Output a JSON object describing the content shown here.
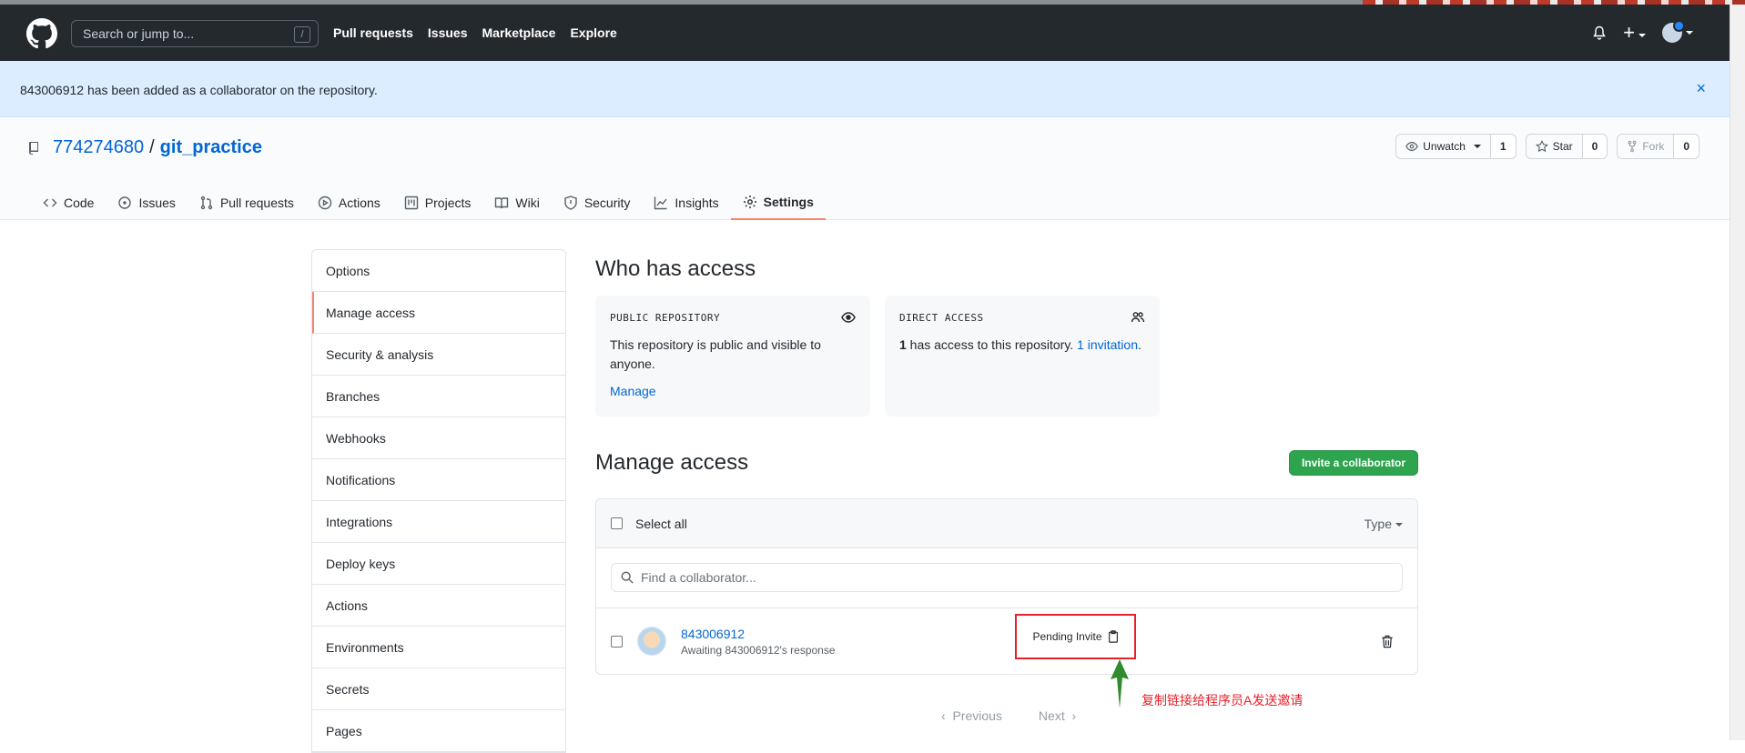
{
  "header": {
    "search_placeholder": "Search or jump to...",
    "search_key": "/",
    "nav": [
      "Pull requests",
      "Issues",
      "Marketplace",
      "Explore"
    ]
  },
  "flash": {
    "message": "843006912 has been added as a collaborator on the repository.",
    "close": "×"
  },
  "repo": {
    "owner": "774274680",
    "separator": "/",
    "name": "git_practice",
    "watch_label": "Unwatch",
    "watch_count": "1",
    "star_label": "Star",
    "star_count": "0",
    "fork_label": "Fork",
    "fork_count": "0"
  },
  "tabs": [
    "Code",
    "Issues",
    "Pull requests",
    "Actions",
    "Projects",
    "Wiki",
    "Security",
    "Insights",
    "Settings"
  ],
  "sidebar": [
    "Options",
    "Manage access",
    "Security & analysis",
    "Branches",
    "Webhooks",
    "Notifications",
    "Integrations",
    "Deploy keys",
    "Actions",
    "Environments",
    "Secrets",
    "Pages"
  ],
  "who_has_access": {
    "title": "Who has access",
    "public_header": "PUBLIC REPOSITORY",
    "public_text": "This repository is public and visible to anyone.",
    "manage_link": "Manage",
    "direct_header": "DIRECT ACCESS",
    "direct_count": "1",
    "direct_text": " has access to this repository. ",
    "invitation_link": "1 invitation",
    "period": "."
  },
  "manage_access": {
    "title": "Manage access",
    "invite_button": "Invite a collaborator",
    "select_all": "Select all",
    "type_filter": "Type",
    "find_placeholder": "Find a collaborator...",
    "collaborator": {
      "name": "843006912",
      "status": "Awaiting 843006912's response",
      "pending": "Pending Invite"
    },
    "pagination": {
      "prev": "Previous",
      "next": "Next"
    }
  },
  "annotation": {
    "text": "复制链接给程序员A发送邀请",
    "color": "#e5222b",
    "arrow_color": "#2e8b2e"
  },
  "colors": {
    "header_bg": "#24292e",
    "flash_bg": "#dbedff",
    "link": "#0366d6",
    "tab_accent": "#f9826c",
    "primary": "#2ea44f"
  }
}
